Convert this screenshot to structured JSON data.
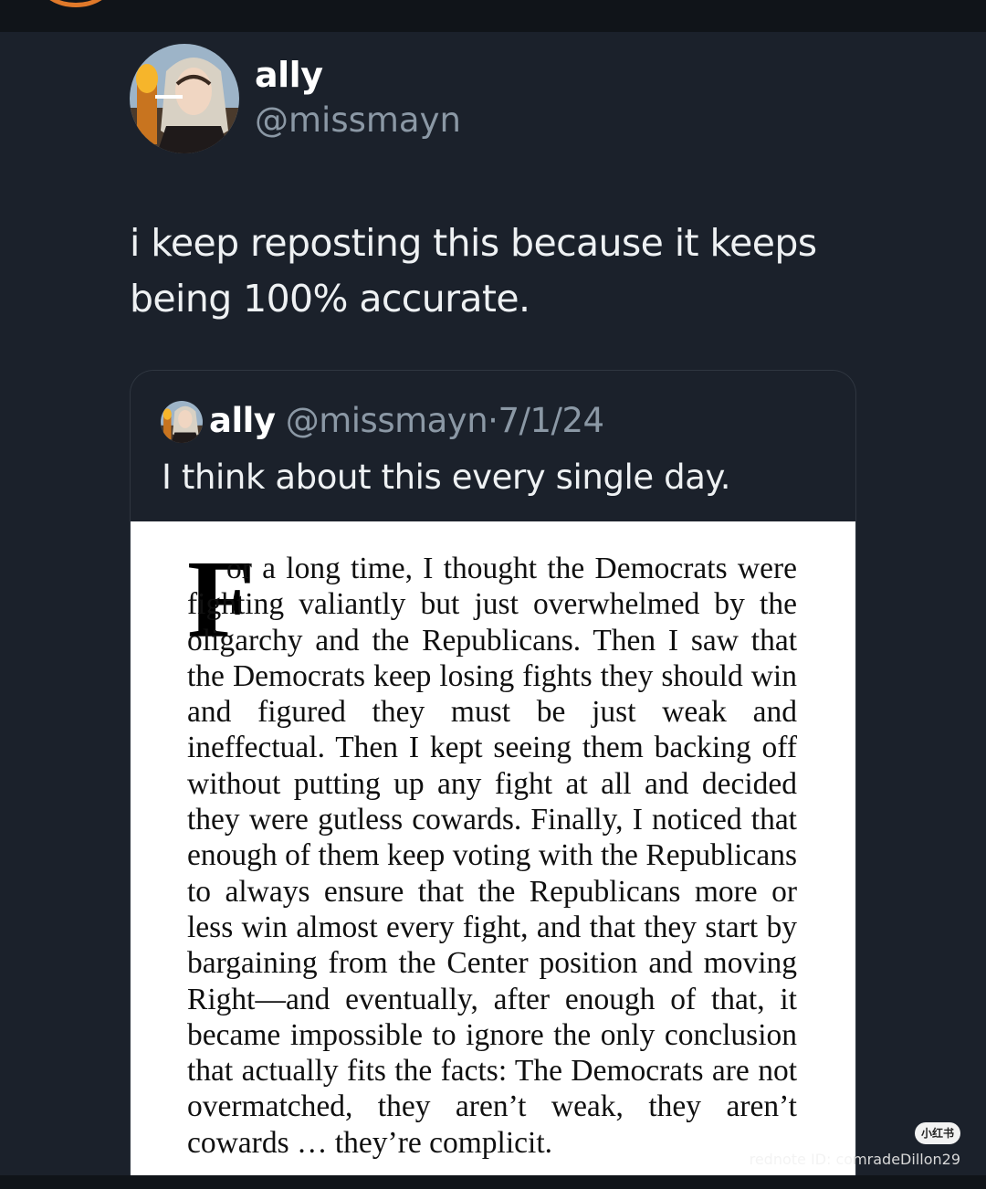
{
  "colors": {
    "background": "#1b212b",
    "text_primary": "#eef1f3",
    "text_secondary": "#8b98a5",
    "card_border": "#2f3640"
  },
  "post": {
    "author": {
      "display_name": "ally",
      "handle": "@missmayn",
      "avatar_icon": "profile-avatar"
    },
    "text": "i keep reposting this because it keeps being 100% accurate."
  },
  "quoted_post": {
    "display_name": "ally",
    "handle": "@missmayn",
    "separator": "·",
    "date": "7/1/24",
    "text": "I think about this every single day.",
    "image": {
      "drop_cap": "F",
      "body": "or a long time, I thought the Democrats were fighting valiantly but just overwhelmed by the oligarchy and the Republicans. Then I saw that the Democrats keep losing fights they should win and figured they must be just weak and ineffectual. Then I kept seeing them backing off without putting up any fight at all and decided they were gutless cowards. Finally, I noticed that enough of them keep voting with the Republicans to always ensure that the Republicans more or less win almost every fight, and that they start by bargaining from the Center position and moving Right—and eventually, after enough of that, it became impossible to ignore the only conclusion that actually fits the facts: The Democrats are not overmatched, they aren’t weak, they aren’t cowards … they’re complicit."
    }
  },
  "watermark": {
    "badge": "小红书",
    "faint_text": "rednote ID: co",
    "user_text": "mradeDillon29"
  }
}
